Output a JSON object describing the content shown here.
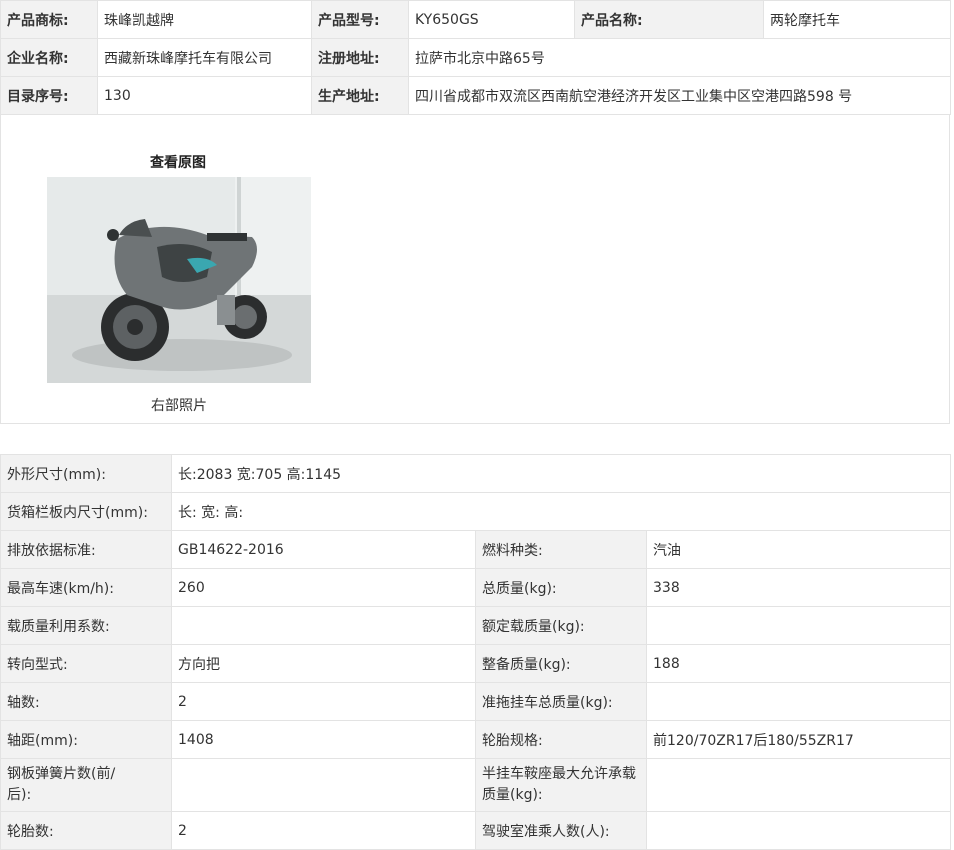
{
  "product": {
    "brand_label": "产品商标:",
    "brand_value": "珠峰凯越牌",
    "model_label": "产品型号:",
    "model_value": "KY650GS",
    "name_label": "产品名称:",
    "name_value": "两轮摩托车",
    "company_label": "企业名称:",
    "company_value": "西藏新珠峰摩托车有限公司",
    "reg_addr_label": "注册地址:",
    "reg_addr_value": "拉萨市北京中路65号",
    "catalog_label": "目录序号:",
    "catalog_value": "130",
    "prod_addr_label": "生产地址:",
    "prod_addr_value": "四川省成都市双流区西南航空港经济开发区工业集中区空港四路598 号"
  },
  "photo": {
    "view_original": "查看原图",
    "caption": "右部照片"
  },
  "specs": {
    "dimensions_label": "外形尺寸(mm):",
    "dimensions_value": "长:2083 宽:705 高:1145",
    "cargo_label": "货箱栏板内尺寸(mm):",
    "cargo_value": "长: 宽: 高:",
    "emission_label": "排放依据标准:",
    "emission_value": "GB14622-2016",
    "fuel_label": "燃料种类:",
    "fuel_value": "汽油",
    "speed_label": "最高车速(km/h):",
    "speed_value": "260",
    "total_mass_label": "总质量(kg):",
    "total_mass_value": "338",
    "load_coef_label": "载质量利用系数:",
    "load_coef_value": "",
    "rated_load_label": "额定载质量(kg):",
    "rated_load_value": "",
    "steering_label": "转向型式:",
    "steering_value": "方向把",
    "curb_mass_label": "整备质量(kg):",
    "curb_mass_value": "188",
    "axles_label": "轴数:",
    "axles_value": "2",
    "trailer_label": "准拖挂车总质量(kg):",
    "trailer_value": "",
    "wheelbase_label": "轴距(mm):",
    "wheelbase_value": "1408",
    "tire_label": "轮胎规格:",
    "tire_value": "前120/70ZR17后180/55ZR17",
    "spring_label_1": "钢板弹簧片数(前/",
    "spring_label_2": "后):",
    "spring_value": "",
    "saddle_label_1": "半挂车鞍座最大允许承载",
    "saddle_label_2": "质量(kg):",
    "saddle_value": "",
    "tires_label": "轮胎数:",
    "tires_value": "2",
    "cab_label": "驾驶室准乘人数(人):",
    "cab_value": ""
  },
  "colors": {
    "label_bg": "#f2f2f2",
    "border": "#e3e3e3",
    "text": "#333333"
  }
}
